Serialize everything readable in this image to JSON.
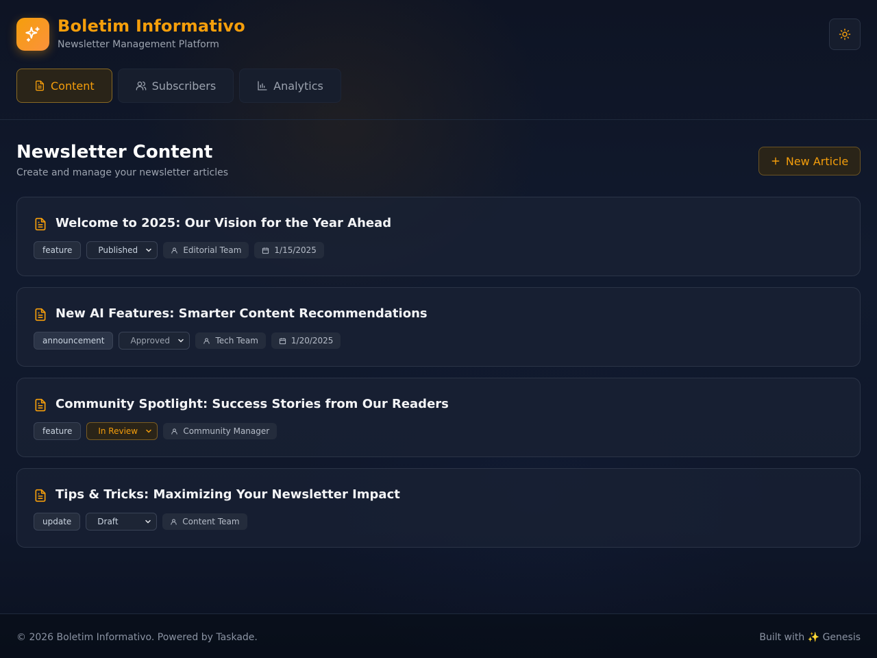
{
  "app": {
    "title": "Boletim Informativo",
    "subtitle": "Newsletter Management Platform",
    "logo_icon": "sparkles-icon",
    "theme_toggle_icon": "sun-icon",
    "accent_color": "#f59e0b"
  },
  "tabs": [
    {
      "label": "Content",
      "icon": "document-icon",
      "active": true
    },
    {
      "label": "Subscribers",
      "icon": "users-icon",
      "active": false
    },
    {
      "label": "Analytics",
      "icon": "bar-chart-icon",
      "active": false
    }
  ],
  "section": {
    "title": "Newsletter Content",
    "subtitle": "Create and manage your newsletter articles",
    "new_button_label": "New Article"
  },
  "articles": [
    {
      "title": "Welcome to 2025: Our Vision for the Year Ahead",
      "tag": "feature",
      "status": "Published",
      "author": "Editorial Team",
      "date": "1/15/2025"
    },
    {
      "title": "New AI Features: Smarter Content Recommendations",
      "tag": "announcement",
      "status": "Approved",
      "author": "Tech Team",
      "date": "1/20/2025"
    },
    {
      "title": "Community Spotlight: Success Stories from Our Readers",
      "tag": "feature",
      "status": "In Review",
      "author": "Community Manager",
      "date": ""
    },
    {
      "title": "Tips & Tricks: Maximizing Your Newsletter Impact",
      "tag": "update",
      "status": "Draft",
      "author": "Content Team",
      "date": ""
    }
  ],
  "footer": {
    "left": "© 2026 Boletim Informativo. Powered by Taskade.",
    "right": "Built with ✨ Genesis"
  }
}
